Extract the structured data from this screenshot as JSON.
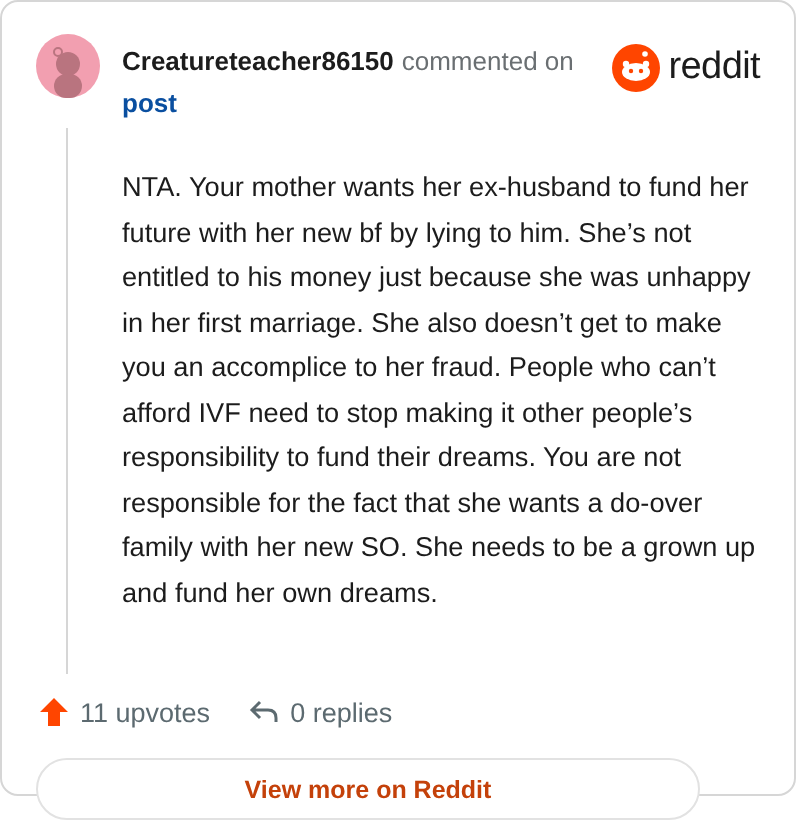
{
  "author": "Creatureteacher86150",
  "action": "commented on",
  "link": "post",
  "brand": "reddit",
  "body": "NTA. Your mother wants her ex-husband to fund her future with her new bf by lying to him. She’s not entitled to his money just because she was unhappy in her first marriage. She also doesn’t get to make you an accomplice to her fraud. People who can’t afford IVF need to stop making it other people’s responsibility to fund their dreams. You are not responsible for the fact that she wants a do-over family with her new SO. She needs to be a grown up and fund her own dreams.",
  "upvotes": "11 upvotes",
  "replies": "0 replies",
  "button": "View more on Reddit"
}
